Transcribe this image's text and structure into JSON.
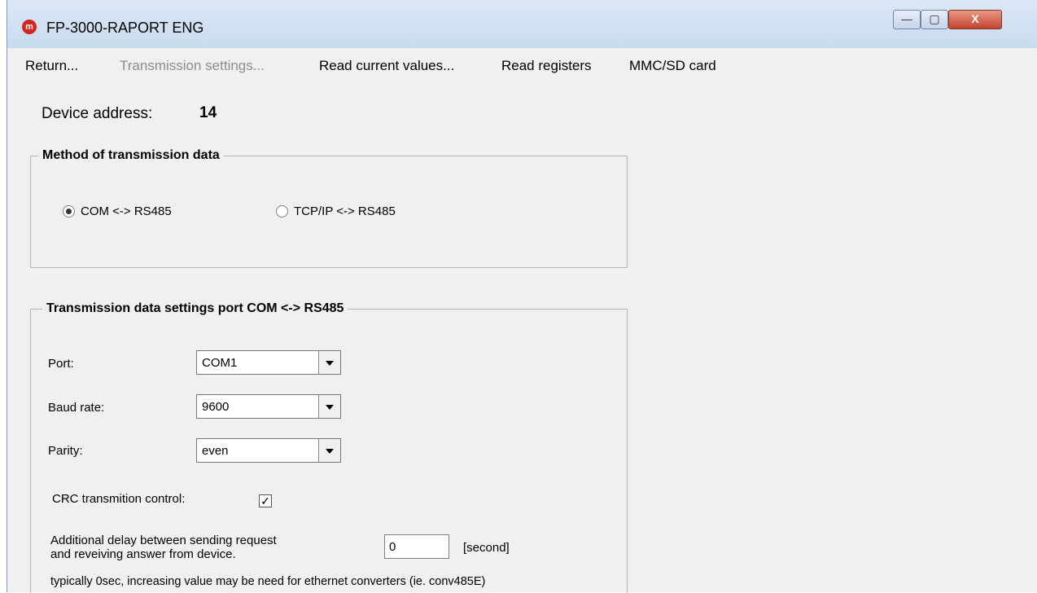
{
  "window": {
    "title": "FP-3000-RAPORT ENG",
    "app_icon_text": "m",
    "controls": {
      "minimize_icon": "minimize-icon",
      "maximize_icon": "maximize-icon",
      "close_icon": "close-icon",
      "minimize_glyph": "—",
      "maximize_glyph": "▢",
      "close_glyph": "X"
    }
  },
  "menu": {
    "items": [
      "Return...",
      "Transmission settings...",
      "Read current values...",
      "Read registers",
      "MMC/SD card"
    ]
  },
  "device": {
    "label": "Device address:",
    "value": "14"
  },
  "method": {
    "title": "Method of transmission data",
    "options": [
      "COM <-> RS485",
      "TCP/IP <-> RS485"
    ],
    "selected": "COM <-> RS485"
  },
  "settings": {
    "title": "Transmission data settings port COM <-> RS485",
    "port": {
      "label": "Port:",
      "value": "COM1"
    },
    "baud": {
      "label": "Baud rate:",
      "value": "9600"
    },
    "parity": {
      "label": "Parity:",
      "value": "even"
    },
    "crc": {
      "label": "CRC transmition control:",
      "checked": true,
      "mark": "✓"
    },
    "delay": {
      "line1": "Additional delay between sending request",
      "line2": "and reveiving answer from device.",
      "value": "0",
      "unit": "[second]",
      "note": "typically 0sec, increasing value may be need for ethernet converters (ie. conv485E)"
    }
  },
  "colors": {
    "window_border": "#7a9ac2",
    "title_bar": "#dbe8f6",
    "close_button": "#c5432f",
    "app_icon": "#d8251c",
    "group_border": "#aeb6bf",
    "disabled_menu_text": "#8d8d8d"
  }
}
